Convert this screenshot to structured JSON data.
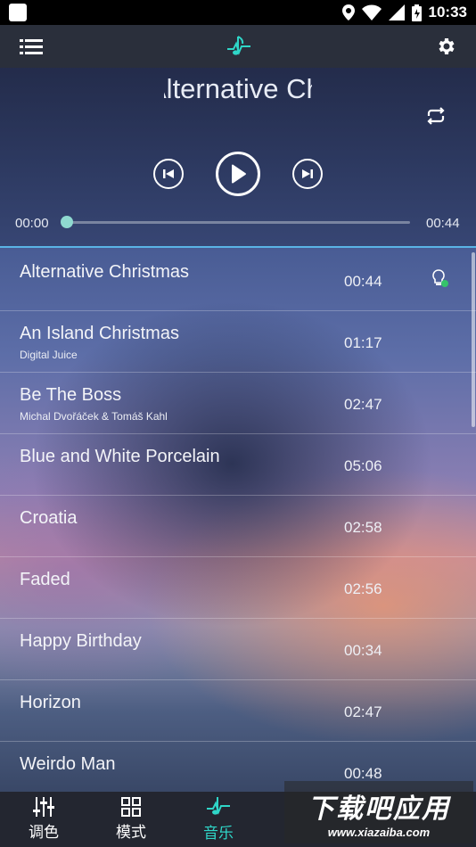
{
  "status_bar": {
    "time": "10:33",
    "icons": [
      "location-icon",
      "wifi-icon",
      "cellular-icon",
      "battery-icon"
    ]
  },
  "header": {
    "menu_icon": "menu-icon",
    "logo_icon": "music-note-icon",
    "settings_icon": "gear-icon"
  },
  "player": {
    "title": "Alternative Christmas",
    "current_time": "00:00",
    "total_time": "00:44",
    "progress": 0.0
  },
  "songs": [
    {
      "name": "Alternative Christmas",
      "artist": "",
      "duration": "00:44",
      "playing": true
    },
    {
      "name": "An Island Christmas",
      "artist": "Digital Juice",
      "duration": "01:17"
    },
    {
      "name": "Be The Boss",
      "artist": "Michal Dvořáček & Tomáš Kahl",
      "duration": "02:47"
    },
    {
      "name": "Blue and White Porcelain",
      "artist": "",
      "duration": "05:06"
    },
    {
      "name": "Croatia",
      "artist": "",
      "duration": "02:58"
    },
    {
      "name": "Faded",
      "artist": "",
      "duration": "02:56"
    },
    {
      "name": "Happy Birthday",
      "artist": "",
      "duration": "00:34"
    },
    {
      "name": "Horizon",
      "artist": "",
      "duration": "02:47"
    },
    {
      "name": "Weirdo Man",
      "artist": "",
      "duration": "00:48"
    }
  ],
  "bottom_nav": {
    "tabs": [
      {
        "label": "调色",
        "icon": "equalizer-icon"
      },
      {
        "label": "模式",
        "icon": "grid-icon"
      },
      {
        "label": "音乐",
        "icon": "music-note-icon",
        "active": true
      }
    ]
  },
  "watermark": {
    "text": "下载吧应用",
    "url": "www.xiazaiba.com"
  },
  "colors": {
    "accent": "#2fd6c8",
    "divider": "#5ab4e6"
  }
}
